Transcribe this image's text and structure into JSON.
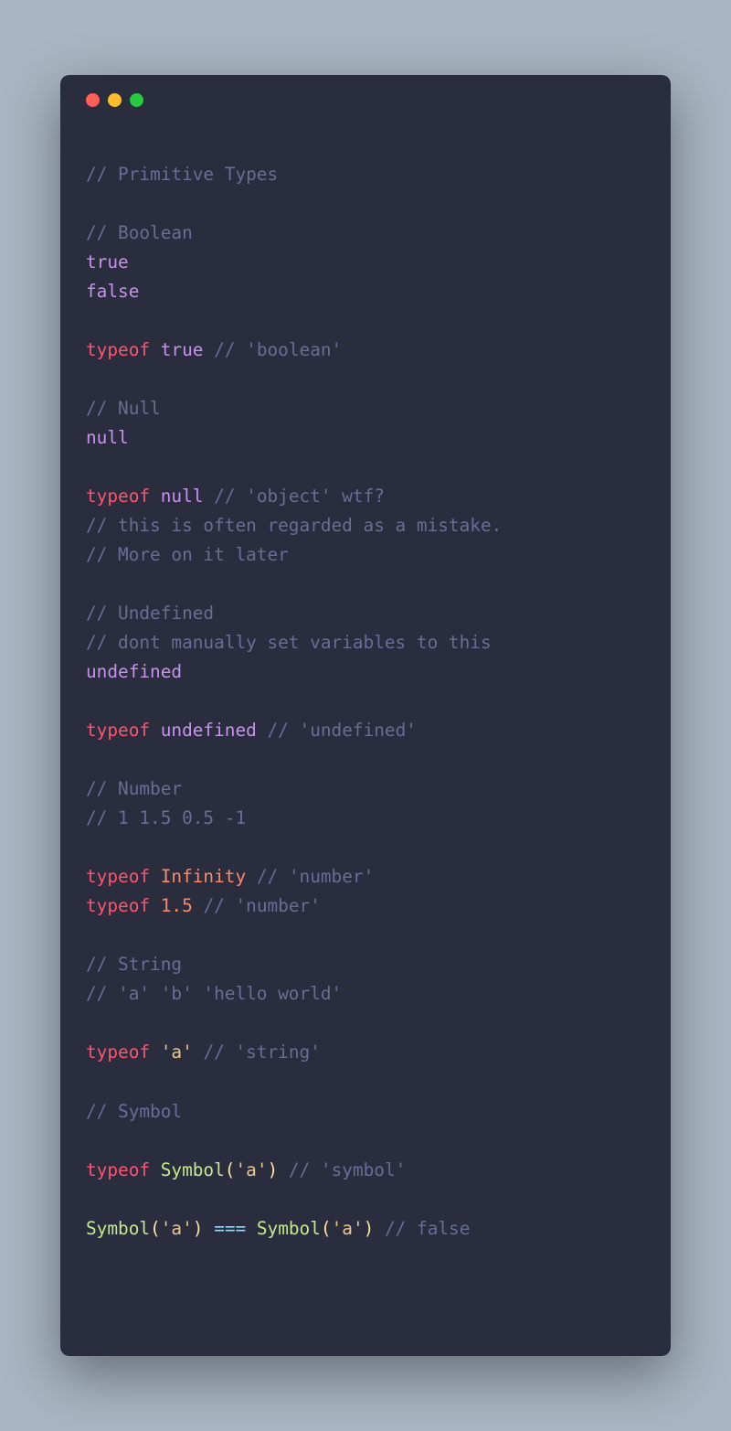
{
  "titlebar": {
    "dots": [
      "red",
      "yellow",
      "green"
    ]
  },
  "code": {
    "l1": "// Primitive Types",
    "l2": "",
    "l3": "// Boolean",
    "l4a": "true",
    "l5a": "false",
    "l6": "",
    "l7a": "typeof",
    "l7b": " ",
    "l7c": "true",
    "l7d": " ",
    "l7e": "// 'boolean'",
    "l8": "",
    "l9": "// Null",
    "l10a": "null",
    "l11": "",
    "l12a": "typeof",
    "l12b": " ",
    "l12c": "null",
    "l12d": " ",
    "l12e": "// 'object' wtf?",
    "l13": "// this is often regarded as a mistake.",
    "l14": "// More on it later",
    "l15": "",
    "l16": "// Undefined",
    "l17": "// dont manually set variables to this",
    "l18a": "undefined",
    "l19": "",
    "l20a": "typeof",
    "l20b": " ",
    "l20c": "undefined",
    "l20d": " ",
    "l20e": "// 'undefined'",
    "l21": "",
    "l22": "// Number",
    "l23": "// 1 1.5 0.5 -1",
    "l24": "",
    "l25a": "typeof",
    "l25b": " ",
    "l25c": "Infinity",
    "l25d": " ",
    "l25e": "// 'number'",
    "l26a": "typeof",
    "l26b": " ",
    "l26c": "1.5",
    "l26d": " ",
    "l26e": "// 'number'",
    "l27": "",
    "l28": "// String",
    "l29": "// 'a' 'b' 'hello world'",
    "l30": "",
    "l31a": "typeof",
    "l31b": " ",
    "l31c": "'a'",
    "l31d": " ",
    "l31e": "// 'string'",
    "l32": "",
    "l33": "// Symbol",
    "l34": "",
    "l35a": "typeof",
    "l35b": " ",
    "l35c": "Symbol",
    "l35d": "(",
    "l35e": "'a'",
    "l35f": ")",
    "l35g": " ",
    "l35h": "// 'symbol'",
    "l36": "",
    "l37a": "Symbol",
    "l37b": "(",
    "l37c": "'a'",
    "l37d": ")",
    "l37e": " ",
    "l37f": "===",
    "l37g": " ",
    "l37h": "Symbol",
    "l37i": "(",
    "l37j": "'a'",
    "l37k": ")",
    "l37l": " ",
    "l37m": "// false"
  }
}
